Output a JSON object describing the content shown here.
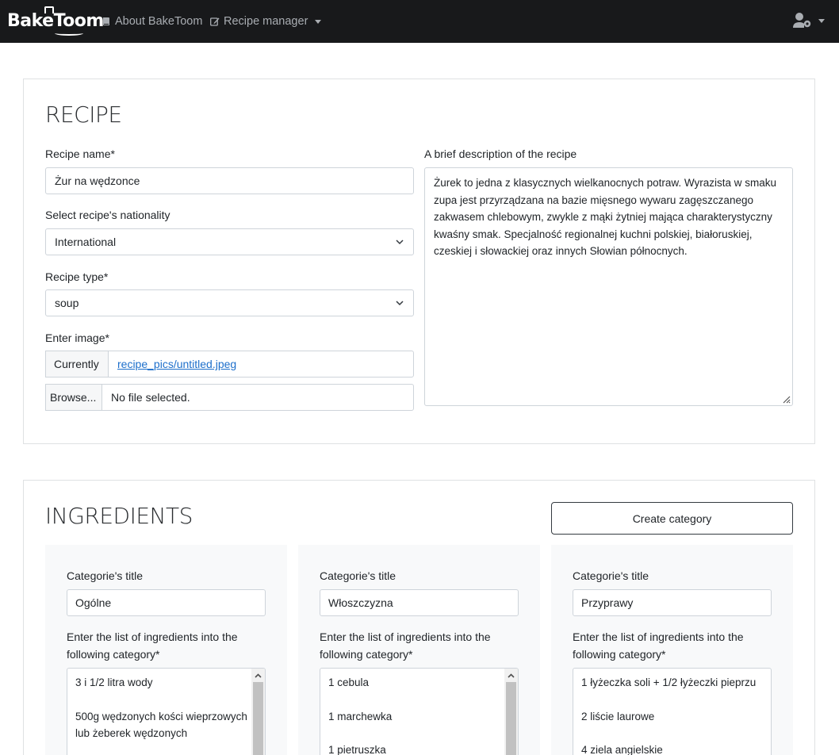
{
  "nav": {
    "brand": "BakeToom",
    "about": "About BakeToom",
    "recipe_manager": "Recipe manager"
  },
  "recipe": {
    "title": "RECIPE",
    "name_label": "Recipe name*",
    "name_value": "Żur na wędzonce",
    "nationality_label": "Select recipe's nationality",
    "nationality_value": "International",
    "type_label": "Recipe type*",
    "type_value": "soup",
    "image_label": "Enter image*",
    "currently_label": "Currently",
    "current_image": "recipe_pics/untitled.jpeg",
    "browse_label": "Browse...",
    "no_file": "No file selected.",
    "description_label": "A brief description of the recipe",
    "description_value": "Żurek to jedna z klasycznych wielkanocnych potraw. Wyrazista w smaku zupa jest przyrządzana na bazie mięsnego wywaru zagęszczanego zakwasem chlebowym, zwykle z mąki żytniej mająca charakterystyczny kwaśny smak. Specjalność regionalnej kuchni polskiej, białoruskiej, czeskiej i słowackiej oraz innych Słowian północnych."
  },
  "ingredients": {
    "title": "INGREDIENTS",
    "create_category": "Create category",
    "categories": [
      {
        "title_label": "Categorie's title",
        "title_value": "Ogólne",
        "list_label": "Enter the list of ingredients into the following category*",
        "list_value": "3 i 1/2 litra wody\n\n500g wędzonych kości wieprzowych lub żeberek wędzonych"
      },
      {
        "title_label": "Categorie's title",
        "title_value": "Włoszczyzna",
        "list_label": "Enter the list of ingredients into the following category*",
        "list_value": "1 cebula\n\n1 marchewka\n\n1 pietruszka"
      },
      {
        "title_label": "Categorie's title",
        "title_value": "Przyprawy",
        "list_label": "Enter the list of ingredients into the following category*",
        "list_value": "1 łyżeczka soli + 1/2 łyżeczki pieprzu\n\n2 liście laurowe\n\n4 ziela angielskie"
      }
    ]
  }
}
